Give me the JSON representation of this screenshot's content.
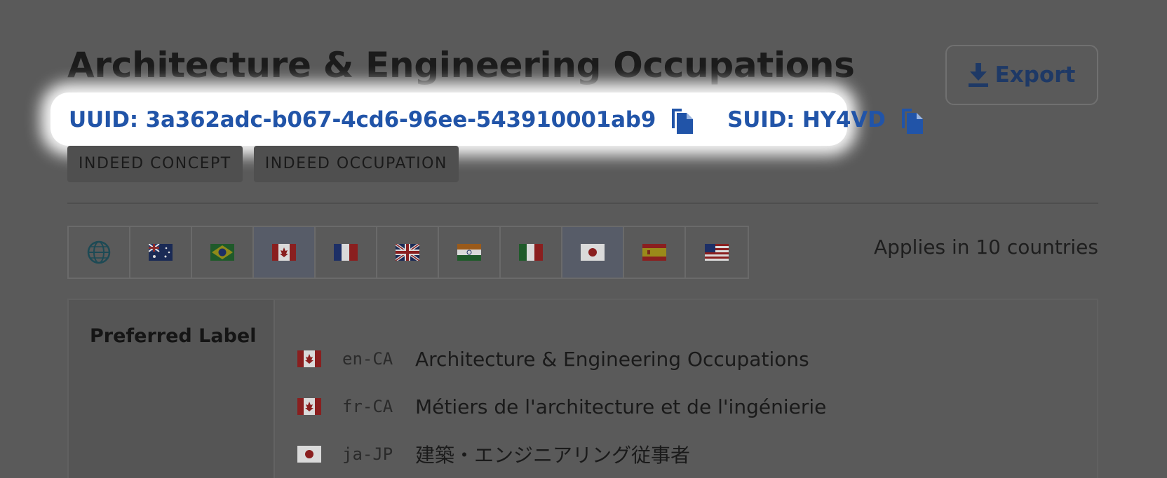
{
  "header": {
    "title": "Architecture & Engineering Occupations",
    "export_label": "Export"
  },
  "ids": {
    "uuid_text": "UUID: 3a362adc-b067-4cd6-96ee-543910001ab9",
    "suid_text": "SUID: HY4VD"
  },
  "tags": [
    "INDEED CONCEPT",
    "INDEED OCCUPATION"
  ],
  "countries": {
    "flags": [
      {
        "name": "global-icon",
        "active": false
      },
      {
        "name": "australia-flag-icon",
        "active": false
      },
      {
        "name": "brazil-flag-icon",
        "active": false
      },
      {
        "name": "canada-flag-icon",
        "active": true
      },
      {
        "name": "france-flag-icon",
        "active": false
      },
      {
        "name": "uk-flag-icon",
        "active": false
      },
      {
        "name": "india-flag-icon",
        "active": false
      },
      {
        "name": "italy-flag-icon",
        "active": false
      },
      {
        "name": "japan-flag-icon",
        "active": true
      },
      {
        "name": "spain-flag-icon",
        "active": false
      },
      {
        "name": "usa-flag-icon",
        "active": false
      }
    ],
    "applies_text": "Applies in 10 countries"
  },
  "preferred_label": {
    "heading": "Preferred Label",
    "items": [
      {
        "flag": "canada-flag-icon",
        "locale": "en-CA",
        "value": "Architecture & Engineering Occupations"
      },
      {
        "flag": "canada-flag-icon",
        "locale": "fr-CA",
        "value": "Métiers de l'architecture et de l'ingénierie"
      },
      {
        "flag": "japan-flag-icon",
        "locale": "ja-JP",
        "value": "建築・エンジニアリング従事者"
      }
    ]
  },
  "colors": {
    "link_blue": "#2154a8",
    "dim_overlay": "#5a5a5a",
    "spotlight": "#ffffff"
  }
}
